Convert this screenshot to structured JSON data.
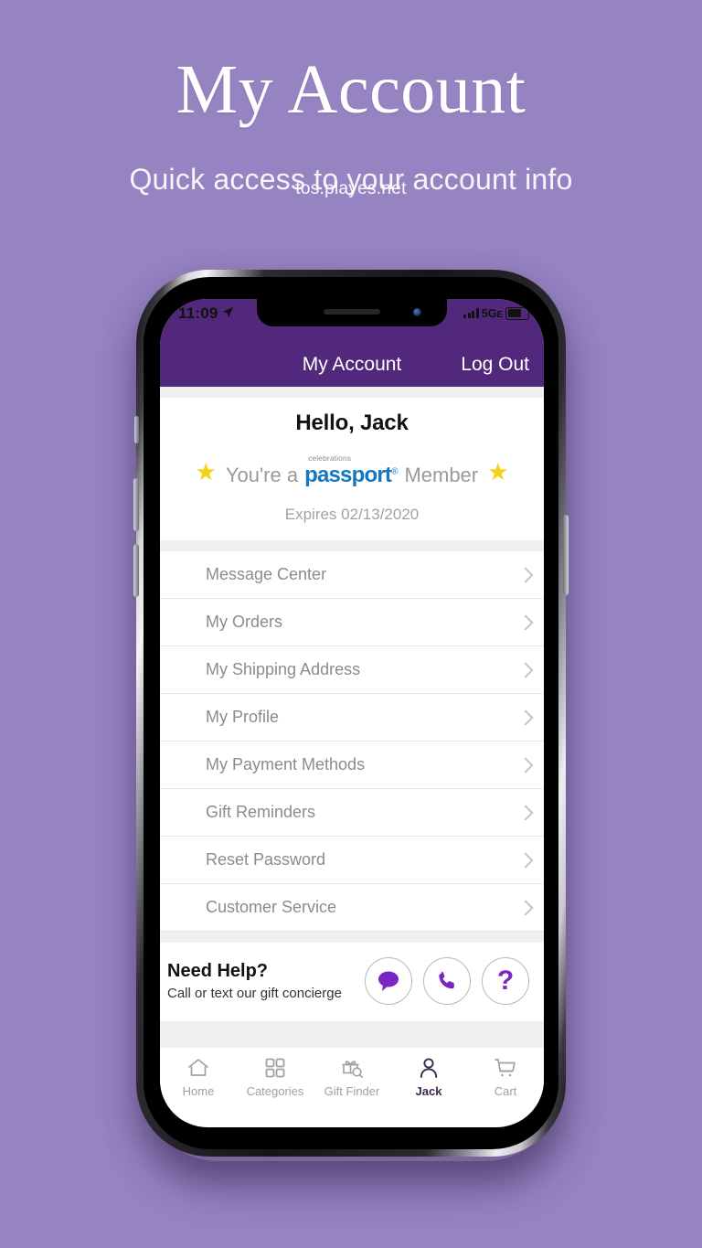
{
  "promo": {
    "title": "My Account",
    "subtitle": "Quick access to your account info",
    "watermark": "tos.playes.net",
    "background_color": "#9684c2"
  },
  "phone": {
    "status_bar": {
      "time": "11:09",
      "location_icon": "location-arrow-icon",
      "signal_icon": "signal-bars-icon",
      "network": "5G",
      "network_suffix": "E",
      "battery_icon": "battery-icon"
    }
  },
  "navbar": {
    "title": "My Account",
    "logout_label": "Log Out",
    "background_color": "#52287c"
  },
  "account": {
    "greeting": "Hello, Jack",
    "member_prefix": "You're a",
    "brand_small": "celebrations",
    "brand_main": "passport",
    "brand_reg": "®",
    "member_suffix": "Member",
    "expires": "Expires 02/13/2020",
    "star_color": "#f5d312",
    "brand_color": "#1478be"
  },
  "menu": {
    "items": [
      {
        "label": "Message Center"
      },
      {
        "label": "My Orders"
      },
      {
        "label": "My Shipping Address"
      },
      {
        "label": "My Profile"
      },
      {
        "label": "My Payment Methods"
      },
      {
        "label": "Gift Reminders"
      },
      {
        "label": "Reset Password"
      },
      {
        "label": "Customer Service"
      }
    ]
  },
  "help": {
    "title": "Need Help?",
    "subtitle": "Call or text our gift concierge",
    "actions": [
      {
        "icon": "chat-bubble-icon"
      },
      {
        "icon": "phone-icon"
      },
      {
        "icon": "question-mark-icon",
        "glyph": "?"
      }
    ],
    "accent_color": "#7b25c4"
  },
  "tabbar": {
    "tabs": [
      {
        "label": "Home",
        "icon": "home-icon",
        "active": false
      },
      {
        "label": "Categories",
        "icon": "grid-icon",
        "active": false
      },
      {
        "label": "Gift Finder",
        "icon": "gift-search-icon",
        "active": false
      },
      {
        "label": "Jack",
        "icon": "person-icon",
        "active": true
      },
      {
        "label": "Cart",
        "icon": "cart-icon",
        "active": false
      }
    ],
    "active_color": "#3b2a4d"
  }
}
